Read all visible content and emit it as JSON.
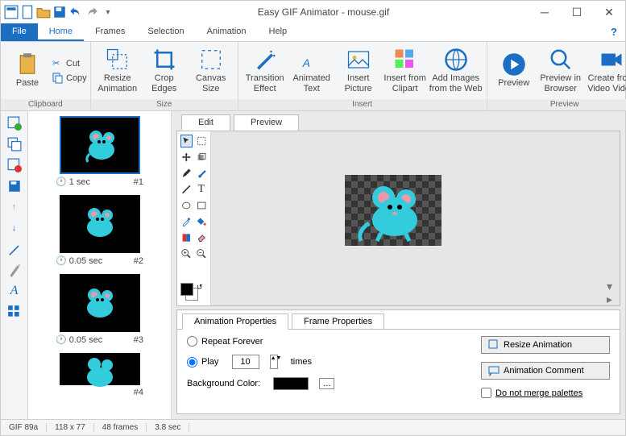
{
  "title": "Easy GIF Animator - mouse.gif",
  "menu": {
    "file": "File",
    "home": "Home",
    "frames": "Frames",
    "selection": "Selection",
    "animation": "Animation",
    "help": "Help"
  },
  "ribbon": {
    "clipboard": {
      "label": "Clipboard",
      "paste": "Paste",
      "cut": "Cut",
      "copy": "Copy"
    },
    "size": {
      "label": "Size",
      "resize": "Resize Animation",
      "crop": "Crop Edges",
      "canvas": "Canvas Size"
    },
    "insert": {
      "label": "Insert",
      "transition": "Transition Effect",
      "text": "Animated Text",
      "picture": "Insert Picture",
      "clipart": "Insert from Clipart",
      "web": "Add Images from the Web"
    },
    "preview": {
      "label": "Preview",
      "preview": "Preview",
      "browser": "Preview in Browser",
      "video": "Create from Video Video"
    }
  },
  "frames": [
    {
      "delay": "1 sec",
      "idx": "#1"
    },
    {
      "delay": "0.05 sec",
      "idx": "#2"
    },
    {
      "delay": "0.05 sec",
      "idx": "#3"
    },
    {
      "delay": "",
      "idx": "#4"
    }
  ],
  "editor": {
    "edit": "Edit",
    "preview": "Preview"
  },
  "props": {
    "animTab": "Animation Properties",
    "frameTab": "Frame Properties",
    "repeat": "Repeat Forever",
    "play": "Play",
    "times": "times",
    "playCount": "10",
    "bgcolor": "Background Color:",
    "resize": "Resize Animation",
    "comment": "Animation Comment",
    "merge": "Do not merge palettes"
  },
  "status": {
    "format": "GIF 89a",
    "dim": "118 x 77",
    "frames": "48 frames",
    "duration": "3.8 sec"
  }
}
